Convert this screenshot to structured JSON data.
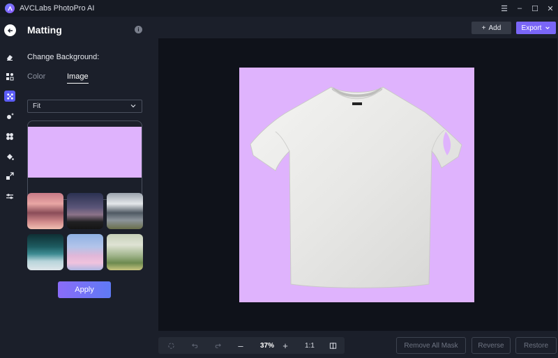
{
  "app": {
    "title": "AVCLabs PhotoPro AI"
  },
  "window_controls": {
    "menu": "☰",
    "minimize": "–",
    "maximize": "☐",
    "close": "✕"
  },
  "rail": {
    "items": [
      {
        "name": "back",
        "icon": "back-arrow-icon"
      },
      {
        "name": "eraser",
        "icon": "eraser-icon"
      },
      {
        "name": "enhance",
        "icon": "grid-enhance-icon"
      },
      {
        "name": "matting",
        "icon": "matting-icon",
        "active": true
      },
      {
        "name": "face",
        "icon": "sparkle-icon"
      },
      {
        "name": "colorize",
        "icon": "fan-icon"
      },
      {
        "name": "fill",
        "icon": "paint-bucket-icon"
      },
      {
        "name": "resize",
        "icon": "resize-icon"
      },
      {
        "name": "adjust",
        "icon": "sliders-icon"
      }
    ]
  },
  "panel": {
    "title": "Matting",
    "section_label": "Change Background:",
    "tabs": [
      {
        "label": "Color",
        "active": false
      },
      {
        "label": "Image",
        "active": true
      }
    ],
    "fit_select": {
      "value": "Fit"
    },
    "background_color": "#dfb3fd",
    "thumbnails": [
      "mountain-sunset",
      "dusk-forest",
      "snowy-mountain",
      "ocean-waves",
      "pink-clouds",
      "meadow-flowers"
    ],
    "apply_label": "Apply"
  },
  "toolbar": {
    "add_label": "Add",
    "export_label": "Export"
  },
  "bottom": {
    "zoom": "37%",
    "ratio": "1:1",
    "remove_all_mask": "Remove All Mask",
    "reverse": "Reverse",
    "restore": "Restore"
  },
  "colors": {
    "accent": "#7a66f7",
    "background_swatch": "#dfb3fd",
    "panel_bg": "#1b1f2a",
    "canvas_bg": "#0f121a"
  }
}
